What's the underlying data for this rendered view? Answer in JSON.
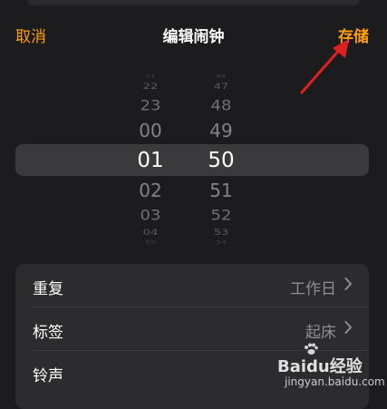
{
  "nav": {
    "cancel_label": "取消",
    "title": "编辑闹钟",
    "save_label": "存储"
  },
  "picker": {
    "hours": [
      "21",
      "22",
      "23",
      "00",
      "01",
      "02",
      "03",
      "04",
      "05"
    ],
    "minutes": [
      "46",
      "47",
      "48",
      "49",
      "50",
      "51",
      "52",
      "53",
      "54"
    ],
    "selected_hour": "01",
    "selected_minute": "50"
  },
  "settings": {
    "rows": [
      {
        "label": "重复",
        "value": "工作日"
      },
      {
        "label": "标签",
        "value": "起床"
      },
      {
        "label": "铃声",
        "value": ""
      }
    ]
  },
  "watermark": {
    "text": "Baidu经验",
    "sub": "jingyan.baidu.com"
  },
  "colors": {
    "accent": "#ff9f0a",
    "arrow": "#e02020",
    "background": "#1c1c1e",
    "card": "#2c2c2e"
  }
}
